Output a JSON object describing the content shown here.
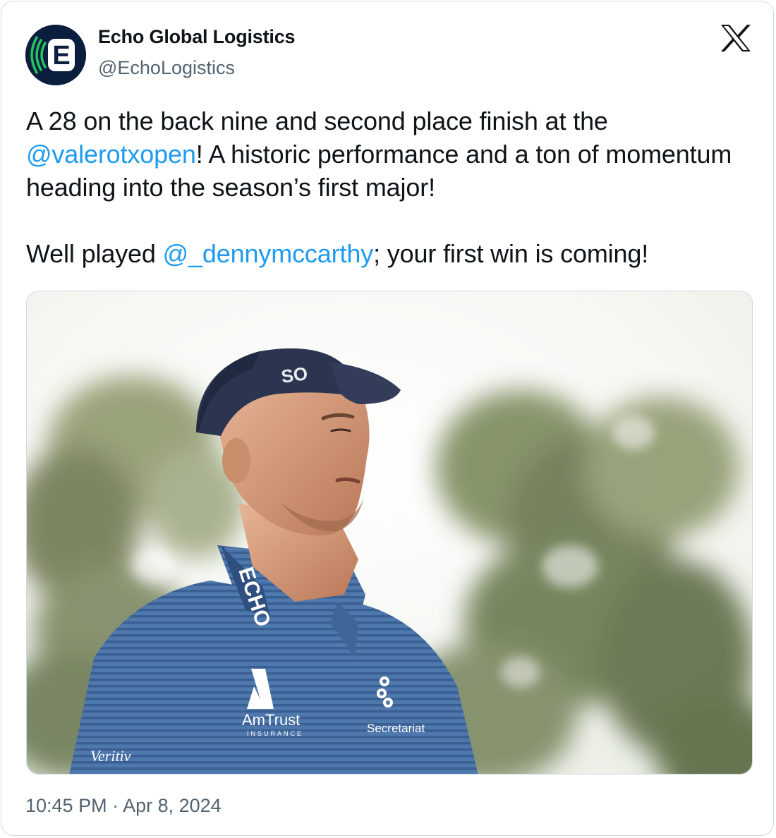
{
  "author": {
    "display_name": "Echo Global Logistics",
    "handle": "@EchoLogistics",
    "avatar_letter": "E",
    "avatar_color": "#0c1e3e",
    "avatar_accent": "#22c55e"
  },
  "platform_icon": "x-logo-icon",
  "tweet": {
    "p1_a": "A 28 on the back nine and second place finish at the ",
    "p1_mention": "@valerotxopen",
    "p1_b": "! A historic performance and a ton of momentum heading into the season’s first major!",
    "p2_a": "Well played ",
    "p2_mention": "@_dennymccarthy",
    "p2_b": "; your first win is coming!"
  },
  "media": {
    "cap_text": "SO",
    "collar_text": "ECHO",
    "logo_primary": "AmTrust",
    "logo_primary_sub": "INSURANCE",
    "logo_secondary": "Secretariat",
    "logo_sleeve": "Veritiv"
  },
  "timestamp": "10:45 PM · Apr 8, 2024",
  "colors": {
    "link": "#1d9bf0",
    "text": "#0f1419",
    "muted": "#536471",
    "border": "#cfd9de"
  }
}
